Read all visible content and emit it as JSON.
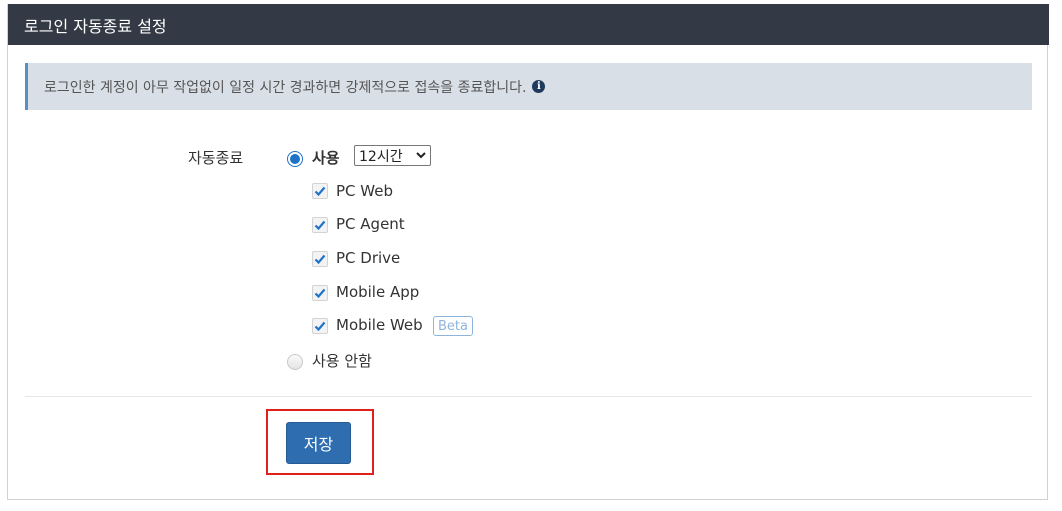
{
  "header": {
    "title": "로그인 자동종료 설정"
  },
  "notice": {
    "text": "로그인한 계정이 아무 작업없이 일정 시간 경과하면 강제적으로 접속을 종료합니다.",
    "icon": "info-icon"
  },
  "form": {
    "field_label": "자동종료",
    "use_option": {
      "label": "사용",
      "selected": true
    },
    "timeout_select": {
      "value": "12시간"
    },
    "checkboxes": [
      {
        "label": "PC Web",
        "checked": true
      },
      {
        "label": "PC Agent",
        "checked": true
      },
      {
        "label": "PC Drive",
        "checked": true
      },
      {
        "label": "Mobile App",
        "checked": true
      },
      {
        "label": "Mobile Web",
        "checked": true,
        "badge": "Beta"
      }
    ],
    "no_use_option": {
      "label": "사용 안함",
      "selected": false
    }
  },
  "actions": {
    "save_label": "저장"
  },
  "colors": {
    "header_bg": "#343a45",
    "accent": "#1e73c9",
    "button": "#2d6db0",
    "highlight": "#e0201c",
    "beta": "#8fb4dc"
  }
}
